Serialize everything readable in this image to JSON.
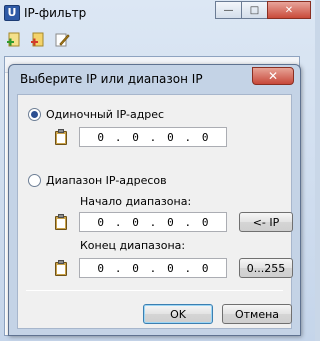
{
  "app": {
    "title": "IP-фильтр",
    "icon": "app-logo-icon"
  },
  "window_controls": {
    "minimize": "—",
    "maximize": "□",
    "close": "✕"
  },
  "toolbar": {
    "icons": [
      "add-icon",
      "add-alt-icon",
      "edit-icon"
    ]
  },
  "dialog": {
    "title": "Выберите IP или диапазон IP",
    "close_glyph": "✕",
    "single": {
      "label": "Одиночный IP-адрес",
      "checked": true,
      "octets": [
        "0",
        "0",
        "0",
        "0"
      ]
    },
    "range": {
      "label": "Диапазон IP-адресов",
      "checked": false,
      "start_label": "Начало диапазона:",
      "start_octets": [
        "0",
        "0",
        "0",
        "0"
      ],
      "start_button": "<- IP",
      "end_label": "Конец диапазона:",
      "end_octets": [
        "0",
        "0",
        "0",
        "0"
      ],
      "end_button": "0...255"
    },
    "ok_label": "OK",
    "cancel_label": "Отмена"
  },
  "colors": {
    "accent": "#2c4f91",
    "close_red": "#c7483a",
    "frame": "#c4d3e6"
  }
}
